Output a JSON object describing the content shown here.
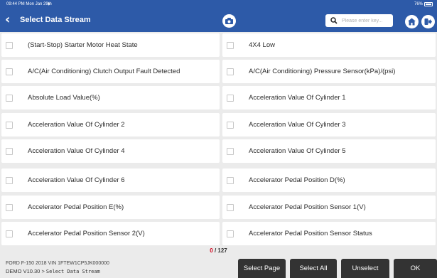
{
  "status_bar": {
    "time": "09:44 PM  Mon Jan 29th",
    "battery": "76%"
  },
  "header": {
    "title": "Select Data Stream",
    "search_placeholder": "Please enter key..."
  },
  "items": [
    "(Start-Stop) Starter Motor Heat State",
    "4X4 Low",
    "A/C(Air Conditioning) Clutch Output Fault Detected",
    "A/C(Air Conditioning) Pressure Sensor(kPa)/(psi)",
    "Absolute Load Value(%)",
    "Acceleration Value Of Cylinder 1",
    "Acceleration Value Of Cylinder 2",
    "Acceleration Value Of Cylinder 3",
    "Acceleration Value Of Cylinder 4",
    "Acceleration Value Of Cylinder 5",
    "Acceleration Value Of Cylinder 6",
    "Accelerator Pedal Position D(%)",
    "Accelerator Pedal Position E(%)",
    "Accelerator Pedal Position Sensor 1(V)",
    "Accelerator Pedal Position Sensor 2(V)",
    "Accelerator Pedal Position Sensor Status"
  ],
  "counter": {
    "selected": "0",
    "total": "/ 127"
  },
  "footer": {
    "vehicle": "FORD  F-150  2018  VIN  1FTEW1CP5JK000000",
    "path_prefix": "DEMO V10.30 >",
    "path_current": "Select Data Stream",
    "buttons": {
      "select_page": "Select Page",
      "select_all": "Select All",
      "unselect": "Unselect",
      "ok": "OK"
    }
  },
  "colors": {
    "header": "#2d5aa8",
    "button": "#333333",
    "counter_selected": "#d0021b",
    "background": "#ebebeb"
  },
  "icons": [
    "back-arrow-icon",
    "camera-icon",
    "search-icon",
    "home-icon",
    "exit-icon",
    "wifi-icon",
    "battery-icon"
  ]
}
